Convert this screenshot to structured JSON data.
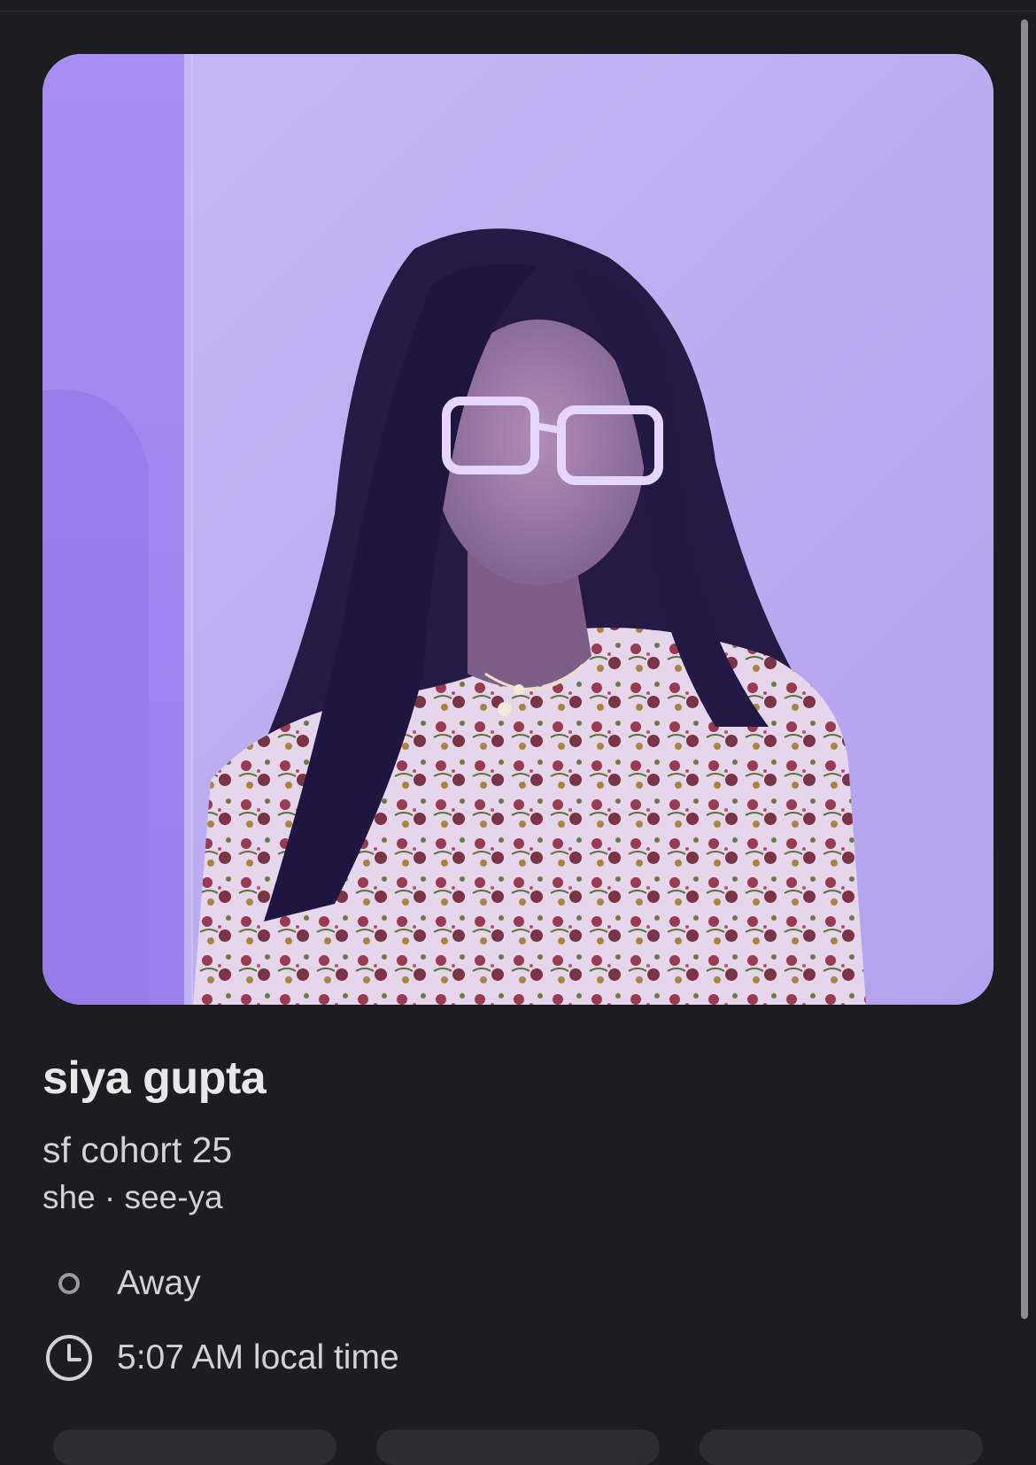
{
  "profile": {
    "name": "siya gupta",
    "title": "sf cohort 25",
    "pronouns": "she · see-ya",
    "status": {
      "text": "Away",
      "icon": "presence-away-icon"
    },
    "local_time": {
      "text": "5:07 AM local time",
      "icon": "clock-icon"
    },
    "photo": {
      "alt": "profile photo"
    }
  },
  "colors": {
    "background": "#1b1d21",
    "text_primary": "#e8e8e8",
    "text_secondary": "#d1d2d3",
    "photo_tint": "#b9a8f0"
  }
}
